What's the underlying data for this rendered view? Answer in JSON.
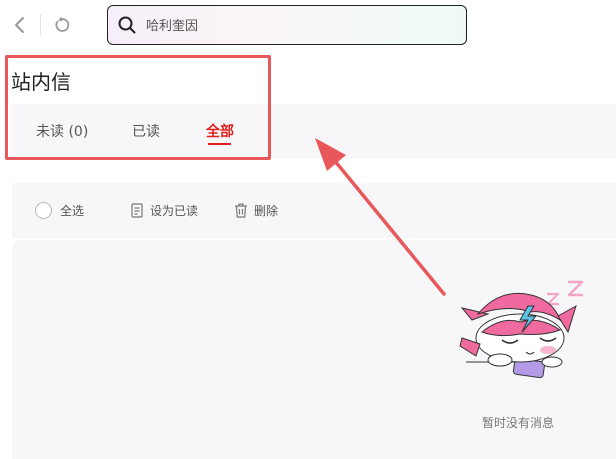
{
  "search": {
    "value": "哈利奎因"
  },
  "page": {
    "title": "站内信"
  },
  "tabs": [
    {
      "label": "未读 (0)"
    },
    {
      "label": "已读"
    },
    {
      "label": "全部"
    }
  ],
  "toolbar": {
    "select_all": "全选",
    "mark_read": "设为已读",
    "delete": "删除"
  },
  "empty": {
    "message": "暂时没有消息"
  },
  "colors": {
    "accent": "#e02020",
    "annotation": "#e8585a"
  },
  "icons": [
    "back-icon",
    "refresh-icon",
    "search-icon",
    "mark-read-icon",
    "trash-icon"
  ]
}
